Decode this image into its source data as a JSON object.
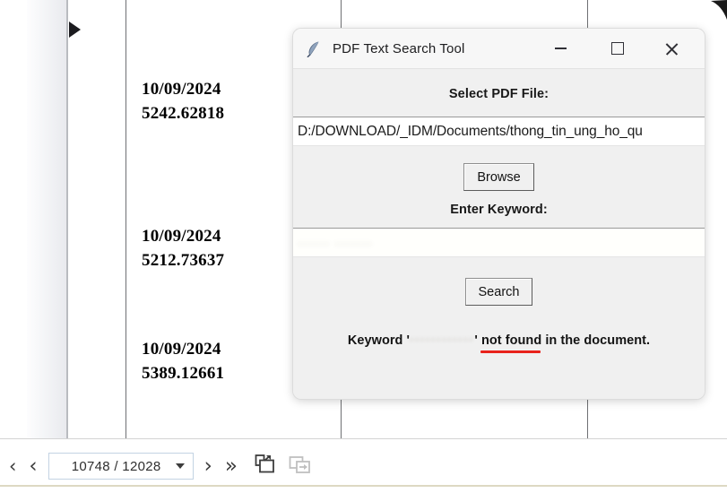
{
  "pdf_viewer": {
    "expand_sidebar_label": "expand-sidebar",
    "entries": [
      {
        "date": "10/09/2024",
        "amount": "5242.62818"
      },
      {
        "date": "10/09/2024",
        "amount": "5212.73637"
      },
      {
        "date": "10/09/2024",
        "amount": "5389.12661"
      }
    ],
    "toolbar": {
      "first_page_label": "‹",
      "prev_page_label": "‹",
      "page_indicator": "10748 / 12028",
      "next_page_label": "›",
      "last_page_label": "»",
      "popout_icon": "popout-window-icon",
      "restore_icon": "restore-window-icon",
      "dropdown_icon": "chevron-down-icon"
    }
  },
  "dialog": {
    "title": "PDF Text Search Tool",
    "app_icon": "feather-quill-icon",
    "window_controls": {
      "minimize": "minimize-icon",
      "maximize": "maximize-icon",
      "close": "close-icon"
    },
    "select_file_label": "Select PDF File:",
    "file_path_value": "D:/DOWNLOAD/_IDM/Documents/thong_tin_ung_ho_qu",
    "browse_label": "Browse",
    "enter_keyword_label": "Enter Keyword:",
    "keyword_value": "······ ·······",
    "search_label": "Search",
    "status": {
      "prefix": "Keyword '",
      "keyword_blurred": "············",
      "quote_close": "' ",
      "highlight": "not found",
      "suffix": " in the document."
    },
    "colors": {
      "underline_red": "#e8221c",
      "dialog_background": "#f0f0f0",
      "titlebar_background": "#f7f7f7"
    }
  }
}
